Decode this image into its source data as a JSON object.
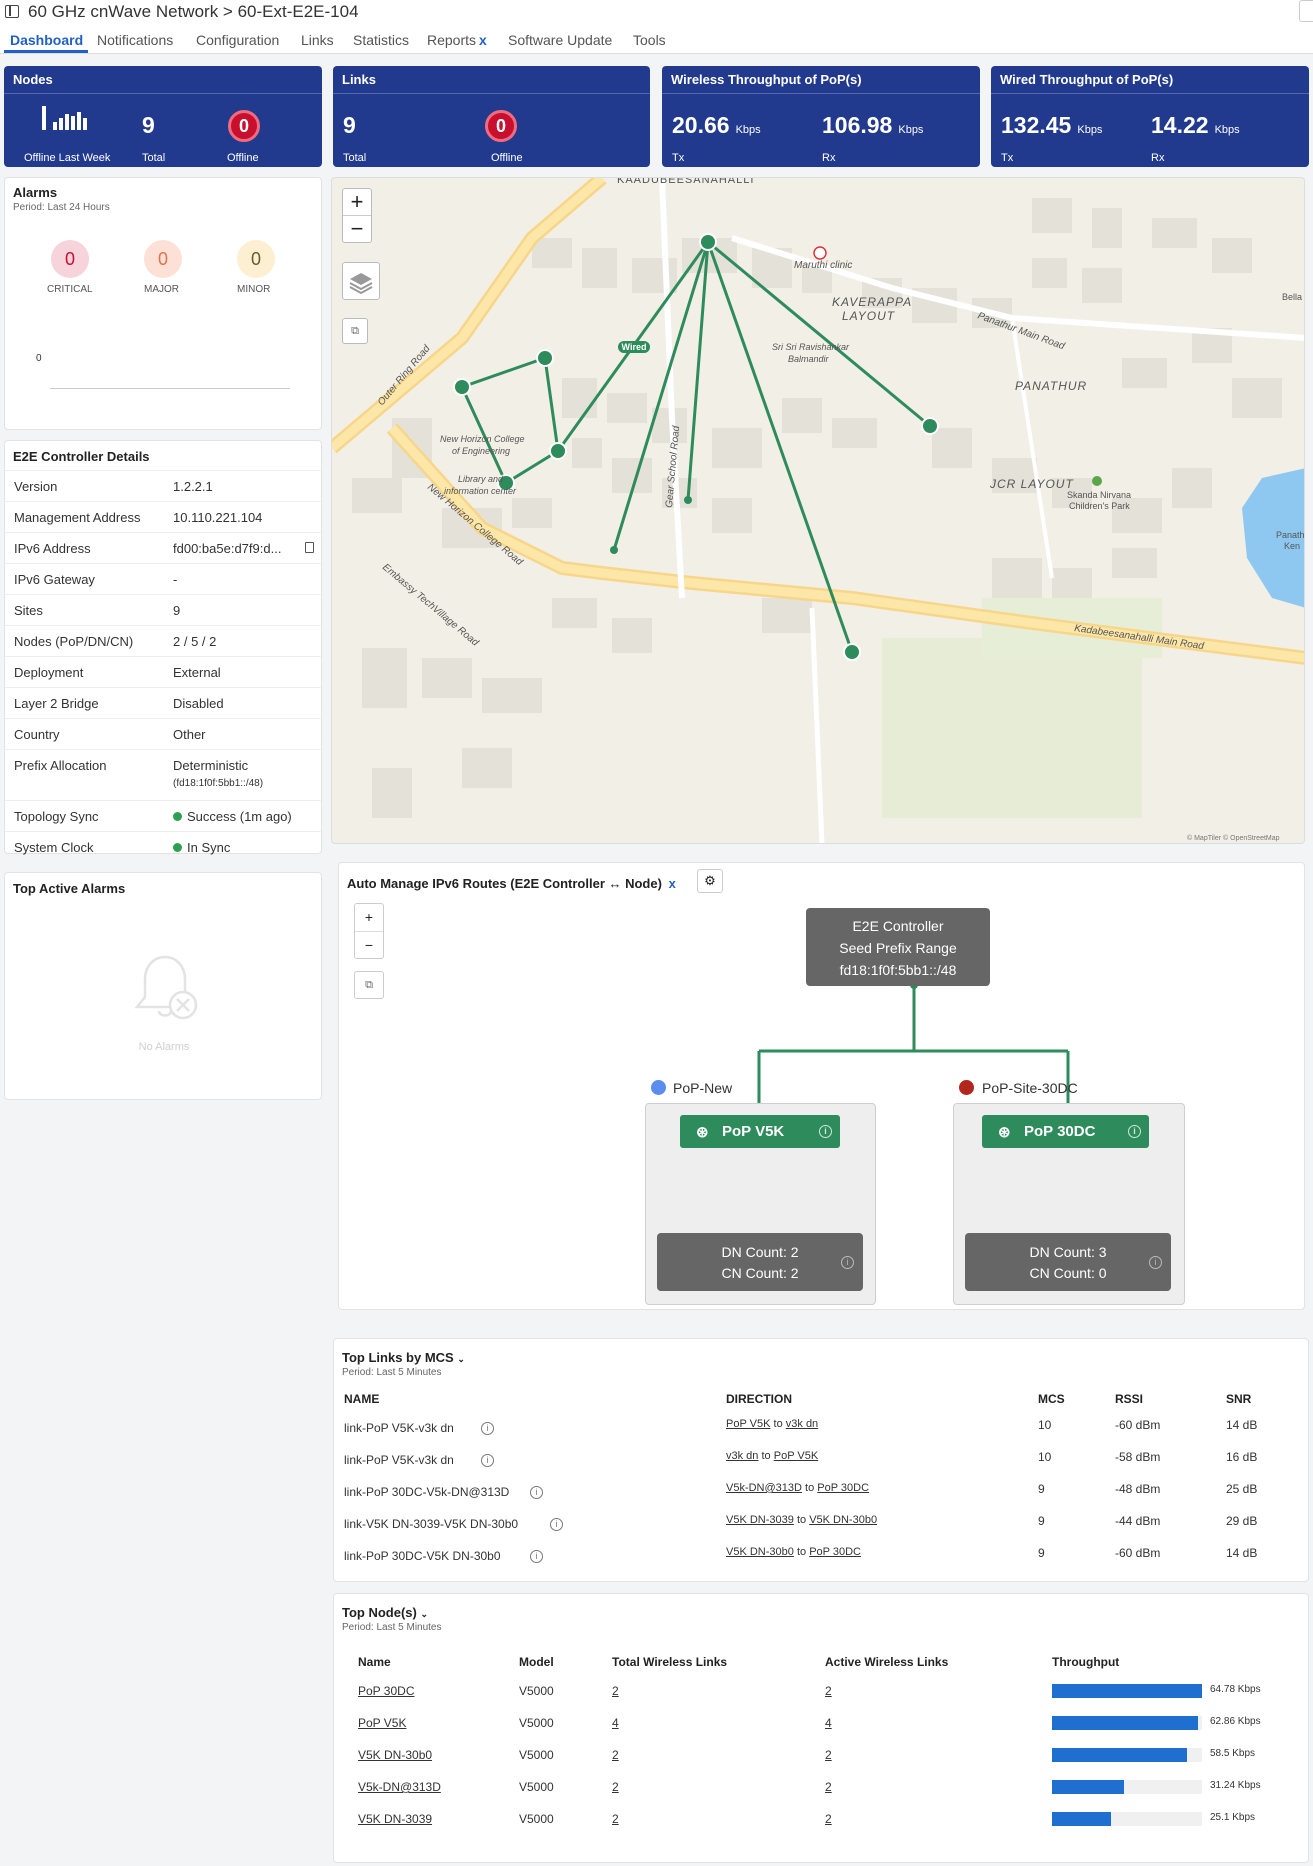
{
  "header": {
    "title": "60 GHz cnWave Network > 60-Ext-E2E-104"
  },
  "tabs": [
    {
      "label": "Dashboard"
    },
    {
      "label": "Notifications"
    },
    {
      "label": "Configuration"
    },
    {
      "label": "Links"
    },
    {
      "label": "Statistics"
    },
    {
      "label": "Reports",
      "suffix": "x"
    },
    {
      "label": "Software Update"
    },
    {
      "label": "Tools"
    }
  ],
  "cards": {
    "nodes": {
      "title": "Nodes",
      "offline_week_label": "Offline Last Week",
      "total": "9",
      "total_label": "Total",
      "offline": "0",
      "offline_label": "Offline"
    },
    "links": {
      "title": "Links",
      "total": "9",
      "total_label": "Total",
      "offline": "0",
      "offline_label": "Offline"
    },
    "wireless": {
      "title": "Wireless Throughput of PoP(s)",
      "tx": "20.66",
      "tx_unit": "Kbps",
      "tx_label": "Tx",
      "rx": "106.98",
      "rx_unit": "Kbps",
      "rx_label": "Rx"
    },
    "wired": {
      "title": "Wired Throughput of PoP(s)",
      "tx": "132.45",
      "tx_unit": "Kbps",
      "tx_label": "Tx",
      "rx": "14.22",
      "rx_unit": "Kbps",
      "rx_label": "Rx"
    }
  },
  "alarms": {
    "title": "Alarms",
    "period": "Period: Last 24 Hours",
    "critical": "0",
    "critical_label": "CRITICAL",
    "major": "0",
    "major_label": "MAJOR",
    "minor": "0",
    "minor_label": "MINOR",
    "axis_zero": "0",
    "colors": {
      "critical": "#f7d3dc",
      "major": "#fde1d6",
      "minor": "#fdf0d2"
    }
  },
  "controller": {
    "title": "E2E Controller Details",
    "rows": [
      {
        "k": "Version",
        "v": "1.2.2.1"
      },
      {
        "k": "Management Address",
        "v": "10.110.221.104"
      },
      {
        "k": "IPv6 Address",
        "v": "fd00:ba5e:d7f9:d..."
      },
      {
        "k": "IPv6 Gateway",
        "v": "-"
      },
      {
        "k": "Sites",
        "v": "9"
      },
      {
        "k": "Nodes (PoP/DN/CN)",
        "v": "2 / 5 / 2"
      },
      {
        "k": "Deployment",
        "v": "External"
      },
      {
        "k": "Layer 2 Bridge",
        "v": "Disabled"
      },
      {
        "k": "Country",
        "v": "Other"
      },
      {
        "k": "Prefix Allocation",
        "v": "Deterministic",
        "v2": "(fd18:1f0f:5bb1::/48)"
      },
      {
        "k": "Topology Sync",
        "v": "Success (1m ago)"
      },
      {
        "k": "System Clock",
        "v": "In Sync"
      }
    ]
  },
  "top_alarms": {
    "title": "Top Active Alarms",
    "empty": "No Alarms"
  },
  "map": {
    "labels": {
      "kaadubee": "KAADUBEESANAHALLI",
      "maruthi": "Maruthi clinic",
      "kaverappa": "KAVERAPPA",
      "layout": "LAYOUT",
      "panathur_road": "Panathur Main Road",
      "bella": "Bella",
      "panathur": "PANATHUR",
      "sri_sri": "Sri Sri Ravishankar",
      "balmandir": "Balmandir",
      "outer_ring": "Outer Ring Road",
      "wired": "Wired",
      "new_horizon": "New Horizon College",
      "of_engg": "of Engineering",
      "library": "Library and",
      "info_center": "information center",
      "gear_school": "Gear School Road",
      "jcr": "JCR LAYOUT",
      "skanda": "Skanda Nirvana",
      "childrens": "Children's Park",
      "panath": "Panath",
      "ken": "Ken",
      "nhc_road": "New Horizon College Road",
      "embassy": "Embassy TechVillage Road",
      "kadabee_road": "Kadabeesanahalli Main Road",
      "attribution": "© MapTiler © OpenStreetMap"
    },
    "zoom_in": "+",
    "zoom_out": "−",
    "link_color": "#2e8b5b"
  },
  "routes": {
    "title": "Auto Manage IPv6 Routes (E2E Controller ↔ Node)",
    "title_x": "x",
    "controller_line1": "E2E Controller",
    "controller_line2": "Seed Prefix Range",
    "controller_line3": "fd18:1f0f:5bb1::/48",
    "zoom_in": "+",
    "zoom_out": "−",
    "groups": [
      {
        "label": "PoP-New",
        "dot_color": "#5b8def",
        "pop": "PoP V5K",
        "dn": "DN Count: 2",
        "cn": "CN Count: 2"
      },
      {
        "label": "PoP-Site-30DC",
        "dot_color": "#b3261e",
        "pop": "PoP 30DC",
        "dn": "DN Count: 3",
        "cn": "CN Count: 0"
      }
    ]
  },
  "top_links": {
    "title": "Top Links by MCS",
    "period": "Period: Last 5 Minutes",
    "headers": [
      "NAME",
      "DIRECTION",
      "MCS",
      "RSSI",
      "SNR"
    ],
    "rows": [
      {
        "name": "link-PoP V5K-v3k dn",
        "from": "PoP V5K",
        "to_word": "to",
        "to": "v3k dn",
        "mcs": "10",
        "rssi": "-60 dBm",
        "snr": "14 dB"
      },
      {
        "name": "link-PoP V5K-v3k dn",
        "from": "v3k dn",
        "to_word": "to",
        "to": "PoP V5K",
        "mcs": "10",
        "rssi": "-58 dBm",
        "snr": "16 dB"
      },
      {
        "name": "link-PoP 30DC-V5k-DN@313D",
        "from": "V5k-DN@313D",
        "to_word": "to",
        "to": "PoP 30DC",
        "mcs": "9",
        "rssi": "-48 dBm",
        "snr": "25 dB"
      },
      {
        "name": "link-V5K DN-3039-V5K DN-30b0",
        "from": "V5K DN-3039",
        "to_word": "to",
        "to": "V5K DN-30b0",
        "mcs": "9",
        "rssi": "-44 dBm",
        "snr": "29 dB"
      },
      {
        "name": "link-PoP 30DC-V5K DN-30b0",
        "from": "V5K DN-30b0",
        "to_word": "to",
        "to": "PoP 30DC",
        "mcs": "9",
        "rssi": "-60 dBm",
        "snr": "14 dB"
      }
    ]
  },
  "top_nodes": {
    "title": "Top Node(s)",
    "period": "Period: Last 5 Minutes",
    "headers": [
      "Name",
      "Model",
      "Total Wireless Links",
      "Active Wireless Links",
      "Throughput"
    ],
    "rows": [
      {
        "name": "PoP 30DC",
        "model": "V5000",
        "total": "2",
        "active": "2",
        "throughput": "64.78 Kbps",
        "fraction": 1.0
      },
      {
        "name": "PoP V5K",
        "model": "V5000",
        "total": "4",
        "active": "4",
        "throughput": "62.86 Kbps",
        "fraction": 0.97
      },
      {
        "name": "V5K DN-30b0",
        "model": "V5000",
        "total": "2",
        "active": "2",
        "throughput": "58.5 Kbps",
        "fraction": 0.9
      },
      {
        "name": "V5k-DN@313D",
        "model": "V5000",
        "total": "2",
        "active": "2",
        "throughput": "31.24 Kbps",
        "fraction": 0.48
      },
      {
        "name": "V5K DN-3039",
        "model": "V5000",
        "total": "2",
        "active": "2",
        "throughput": "25.1 Kbps",
        "fraction": 0.39
      }
    ]
  }
}
